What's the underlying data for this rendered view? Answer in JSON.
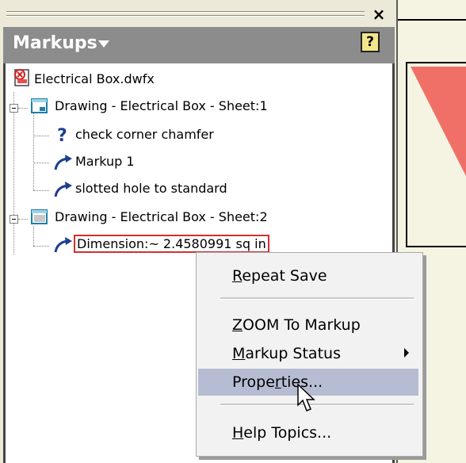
{
  "panel": {
    "title": "Markups",
    "help_label": "?",
    "close_label": "×"
  },
  "tree": {
    "root": {
      "label": "Electrical Box.dwfx",
      "icon": "dwfx-file-icon"
    },
    "sheets": [
      {
        "label": "Drawing - Electrical Box - Sheet:1",
        "icon": "sheet-icon",
        "markups": [
          {
            "label": "check corner chamfer",
            "icon": "question-icon"
          },
          {
            "label": "Markup 1",
            "icon": "markup-arrow-icon"
          },
          {
            "label": "slotted hole to standard",
            "icon": "markup-arrow-icon"
          }
        ]
      },
      {
        "label": "Drawing - Electrical Box - Sheet:2",
        "icon": "sheet-icon",
        "markups": [
          {
            "label": "Dimension:~ 2.4580991 sq in",
            "icon": "markup-arrow-icon",
            "selected": true
          }
        ]
      }
    ]
  },
  "context_menu": {
    "items": [
      {
        "key": "R",
        "rest": "epeat Save"
      },
      {
        "key": "Z",
        "rest": "OOM To Markup"
      },
      {
        "key": "M",
        "rest": "arkup Status",
        "submenu": true
      },
      {
        "pre": "Prope",
        "key": "r",
        "rest": "ties...",
        "highlighted": true
      },
      {
        "key": "H",
        "rest": "elp Topics..."
      }
    ]
  },
  "colors": {
    "panel_header": "#8c8c8c",
    "menu_highlight": "#b6bdd2",
    "selection_border": "#d23030",
    "document_triangle": "#f07068",
    "icon_blue": "#1f3f8f"
  }
}
